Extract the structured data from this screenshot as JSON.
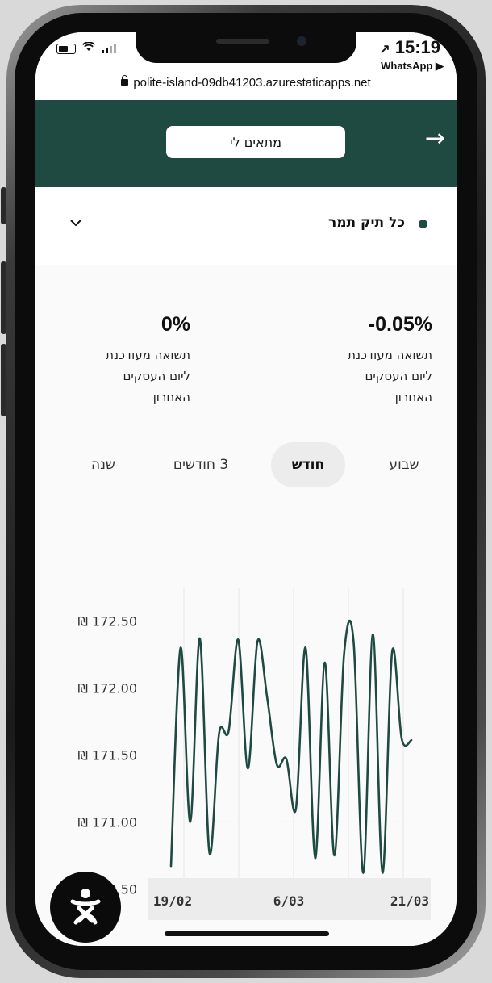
{
  "status_bar": {
    "time": "15:19",
    "back_app": "WhatsApp ▶",
    "url": "polite-island-09db41203.azurestaticapps.net",
    "icons": [
      "battery-icon",
      "wifi-icon",
      "signal-icon",
      "location-arrow-icon",
      "lock-icon"
    ]
  },
  "header": {
    "button_label": "מתאים לי",
    "arrow": "→",
    "background_color": "#1f4a42"
  },
  "selector": {
    "label": "כל תיק תמר",
    "chevron": "⌄"
  },
  "returns": [
    {
      "value": "-0.05%",
      "desc_lines": [
        "תשואה מעודכנת",
        "ליום העסקים",
        "האחרון"
      ]
    },
    {
      "value": "0%",
      "desc_lines": [
        "תשואה מעודכנת",
        "ליום העסקים",
        "האחרון"
      ]
    }
  ],
  "tabs": [
    {
      "label": "שבוע",
      "active": false
    },
    {
      "label": "חודש",
      "active": true
    },
    {
      "label": "3 חודשים",
      "active": false
    },
    {
      "label": "שנה",
      "active": false
    }
  ],
  "chart_data": {
    "type": "line",
    "y_ticks": [
      "₪ 172.50",
      "₪ 172.00",
      "₪ 171.50",
      "₪ 171.00",
      "₪ 170.50"
    ],
    "y_tick_values": [
      172.5,
      172.0,
      171.5,
      171.0,
      170.5
    ],
    "x_ticks": [
      "19/02",
      "6/03",
      "21/03"
    ],
    "ylim": [
      170.4,
      172.75
    ],
    "grid": true,
    "line_color": "#1f4a42",
    "series": [
      {
        "values": [
          170.67,
          172.3,
          171.0,
          172.37,
          170.77,
          171.66,
          171.68,
          172.36,
          171.4,
          172.35,
          171.93,
          171.43,
          171.47,
          171.1,
          172.3,
          170.73,
          172.19,
          170.75,
          172.25,
          172.34,
          170.62,
          172.4,
          170.62,
          172.27,
          171.62,
          171.61
        ]
      }
    ]
  },
  "fab": {
    "icon": "assistant-logo-icon"
  }
}
